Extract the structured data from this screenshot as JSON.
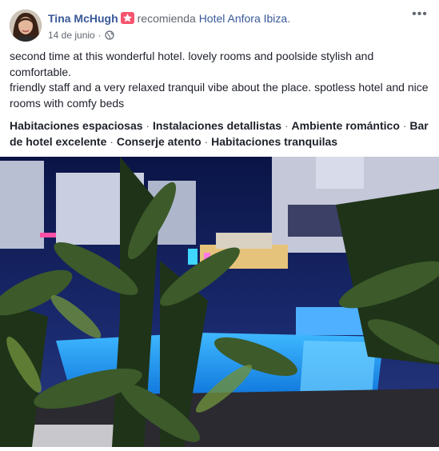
{
  "post": {
    "author": "Tina McHugh",
    "verb": "recomienda",
    "page": "Hotel Anfora Ibiza",
    "date": "14 de junio",
    "separator": "·",
    "privacy_icon": "globe-icon",
    "recommend_icon": "star-badge-icon",
    "more_icon": "more-options-icon",
    "more_glyph": "•••",
    "body_lines": [
      "second time at this wonderful hotel. lovely rooms and poolside stylish and comfortable.",
      "friendly staff and a very relaxed tranquil vibe about the place. spotless hotel and nice rooms with comfy beds"
    ],
    "tags": [
      "Habitaciones espaciosas",
      "Instalaciones detallistas",
      "Ambiente romántico",
      "Bar de hotel excelente",
      "Conserje atento",
      "Habitaciones tranquilas"
    ],
    "tag_separator": " · "
  },
  "colors": {
    "link": "#385898",
    "badge": "#f7546e",
    "meta": "#616770",
    "text": "#1d2129"
  }
}
